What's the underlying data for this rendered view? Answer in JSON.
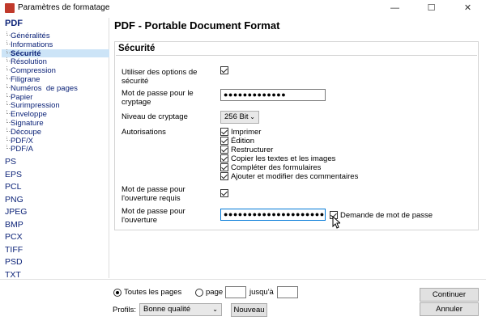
{
  "window": {
    "title": "Paramètres de formatage",
    "minimize": "—",
    "maximize": "☐",
    "close": "✕"
  },
  "sidebar": {
    "root": "PDF",
    "pdf_children": [
      {
        "label": "Généralités",
        "selected": false
      },
      {
        "label": "Informations",
        "selected": false
      },
      {
        "label": "Sécurité",
        "selected": true
      },
      {
        "label": "Résolution",
        "selected": false
      },
      {
        "label": "Compression",
        "selected": false
      },
      {
        "label": "Filigrane",
        "selected": false
      },
      {
        "label": "Numéros  de pages",
        "selected": false
      },
      {
        "label": "Papier",
        "selected": false
      },
      {
        "label": "Surimpression",
        "selected": false
      },
      {
        "label": "Enveloppe",
        "selected": false
      },
      {
        "label": "Signature",
        "selected": false
      },
      {
        "label": "Découpe",
        "selected": false
      },
      {
        "label": "PDF/X",
        "selected": false
      },
      {
        "label": "PDF/A",
        "selected": false
      }
    ],
    "formats": [
      "PS",
      "EPS",
      "PCL",
      "PNG",
      "JPEG",
      "BMP",
      "PCX",
      "TIFF",
      "PSD",
      "TXT"
    ]
  },
  "main": {
    "title": "PDF - Portable Document Format",
    "section_title": "Sécurité",
    "use_security_label": "Utiliser des options de sécurité",
    "use_security_checked": true,
    "owner_password_label": "Mot de passe pour le cryptage",
    "owner_password_value": "●●●●●●●●●●●●●",
    "encryption_level_label": "Niveau de cryptage",
    "encryption_level_value": "256 Bit",
    "permissions_label": "Autorisations",
    "permissions": [
      {
        "label": "Imprimer",
        "checked": true
      },
      {
        "label": "Édition",
        "checked": true
      },
      {
        "label": "Restructurer",
        "checked": true
      },
      {
        "label": "Copier les textes et les images",
        "checked": true
      },
      {
        "label": "Compléter des formulaires",
        "checked": true
      },
      {
        "label": "Ajouter et modifier des commentaires",
        "checked": true
      }
    ],
    "open_password_required_label": "Mot de passe pour l'ouverture requis",
    "open_password_required_checked": true,
    "open_password_label": "Mot de passe pour l'ouverture",
    "open_password_value": "●●●●●●●●●●●●●●●●●●●●●●",
    "ask_password_label": "Demande de mot de passe",
    "ask_password_checked": true
  },
  "bottom": {
    "all_pages_label": "Toutes les pages",
    "page_label": "page",
    "to_label": "jusqu'à",
    "page_from_value": "",
    "page_to_value": "",
    "profiles_label": "Profils:",
    "profile_value": "Bonne qualité",
    "new_button": "Nouveau",
    "continue_button": "Continuer",
    "cancel_button": "Annuler"
  }
}
